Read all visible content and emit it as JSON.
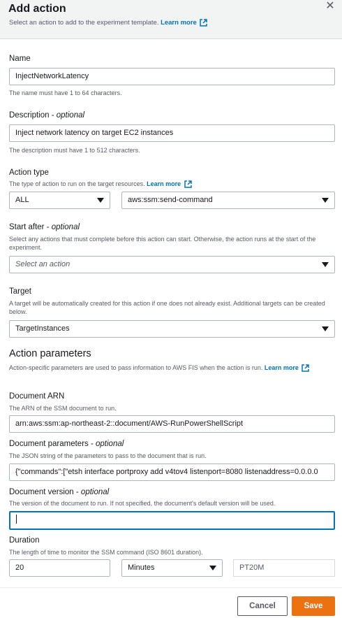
{
  "dialog": {
    "title": "Add action",
    "subtitle": "Select an action to add to the experiment template.",
    "learn_more": "Learn more",
    "close_label": "✕"
  },
  "name": {
    "label": "Name",
    "value": "InjectNetworkLatency",
    "help": "The name must have 1 to 64 characters."
  },
  "description": {
    "label": "Description",
    "optional": "optional",
    "value": "Inject network latency on target EC2 instances",
    "help": "The description must have 1 to 512 characters."
  },
  "action_type": {
    "label": "Action type",
    "help": "The type of action to run on the target resources.",
    "learn_more": "Learn more",
    "category_value": "ALL",
    "action_value": "aws:ssm:send-command"
  },
  "start_after": {
    "label": "Start after",
    "optional": "optional",
    "help": "Select any actions that must complete before this action can start. Otherwise, the action runs at the start of the experiment.",
    "placeholder": "Select an action"
  },
  "target": {
    "label": "Target",
    "help": "A target will be automatically created for this action if one does not already exist. Additional targets can be created below.",
    "value": "TargetInstances"
  },
  "action_parameters": {
    "title": "Action parameters",
    "help": "Action-specific parameters are used to pass information to AWS FIS when the action is run.",
    "learn_more": "Learn more"
  },
  "document_arn": {
    "label": "Document ARN",
    "help": "The ARN of the SSM document to run.",
    "value": "arn:aws:ssm:ap-northeast-2::document/AWS-RunPowerShellScript"
  },
  "document_parameters": {
    "label": "Document parameters",
    "optional": "optional",
    "help": "The JSON string of the parameters to pass to the document that is run.",
    "value": "{\"commands\":[\"etsh interface portproxy add v4tov4 listenport=8080 listenaddress=0.0.0.0"
  },
  "document_version": {
    "label": "Document version",
    "optional": "optional",
    "help": "The version of the document to run. If not specified, the document's default version will be used.",
    "value": ""
  },
  "duration": {
    "label": "Duration",
    "help": "The length of time to monitor the SSM command (ISO 8601 duration).",
    "value": "20",
    "unit": "Minutes",
    "iso": "PT20M"
  },
  "footer": {
    "cancel": "Cancel",
    "save": "Save"
  },
  "colors": {
    "link": "#0073bb",
    "primary": "#ec7211",
    "header_bg": "#f2f3f3"
  }
}
